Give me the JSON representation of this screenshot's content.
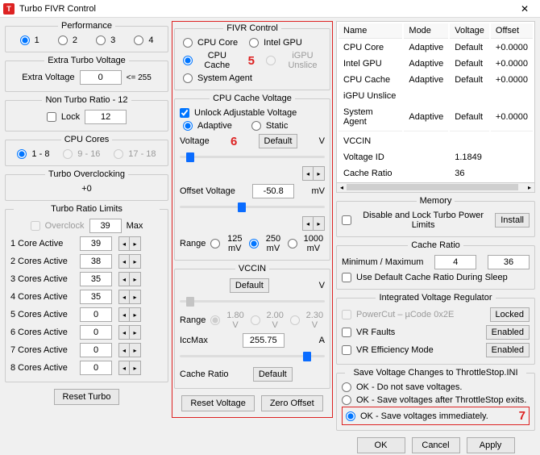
{
  "window": {
    "title": "Turbo FIVR Control",
    "icon_letter": "T"
  },
  "performance": {
    "legend": "Performance",
    "opts": [
      "1",
      "2",
      "3",
      "4"
    ],
    "selected": 0
  },
  "extra_turbo": {
    "legend": "Extra Turbo Voltage",
    "label": "Extra Voltage",
    "value": "0",
    "hint": "<= 255"
  },
  "non_turbo": {
    "legend": "Non Turbo Ratio - 12",
    "cb": "Lock",
    "value": "12"
  },
  "cpu_cores": {
    "legend": "CPU Cores",
    "opts": [
      "1 - 8",
      "9 - 16",
      "17 - 18"
    ]
  },
  "toc": {
    "legend": "Turbo Overclocking",
    "value": "+0"
  },
  "trl": {
    "legend": "Turbo Ratio Limits",
    "cb": "Overclock",
    "multi": "39",
    "multi_suffix": "Max",
    "rows": [
      {
        "label": "1 Core Active",
        "val": "39"
      },
      {
        "label": "2 Cores Active",
        "val": "38"
      },
      {
        "label": "3 Cores Active",
        "val": "35"
      },
      {
        "label": "4 Cores Active",
        "val": "35"
      },
      {
        "label": "5 Cores Active",
        "val": "0"
      },
      {
        "label": "6 Cores Active",
        "val": "0"
      },
      {
        "label": "7 Cores Active",
        "val": "0"
      },
      {
        "label": "8 Cores Active",
        "val": "0"
      }
    ]
  },
  "fivr": {
    "legend": "FIVR Control",
    "annot": "5",
    "radios": [
      [
        "CPU Core",
        "Intel GPU"
      ],
      [
        "CPU Cache",
        "iGPU Unslice"
      ],
      [
        "System Agent",
        ""
      ]
    ],
    "selected": "CPU Cache"
  },
  "cache_v": {
    "legend": "CPU Cache Voltage",
    "unlock": "Unlock Adjustable Voltage",
    "mode_opts": [
      "Adaptive",
      "Static"
    ],
    "voltage_lab": "Voltage",
    "annot": "6",
    "default_btn": "Default",
    "unit_v": "V",
    "offset_lab": "Offset Voltage",
    "offset_val": "-50.8",
    "unit_mv": "mV",
    "range_lab": "Range",
    "range_opts": [
      "125 mV",
      "250 mV",
      "1000 mV"
    ]
  },
  "vccin": {
    "legend": "VCCIN",
    "default_btn": "Default",
    "unit_v": "V",
    "range_lab": "Range",
    "range_opts": [
      "1.80 V",
      "2.00 V",
      "2.30 V"
    ],
    "icc_lab": "IccMax",
    "icc_val": "255.75",
    "icc_unit": "A",
    "cache_ratio_lab": "Cache Ratio",
    "default_btn2": "Default"
  },
  "table": {
    "headers": [
      "Name",
      "Mode",
      "Voltage",
      "Offset"
    ],
    "rows": [
      [
        "CPU Core",
        "Adaptive",
        "Default",
        "+0.0000"
      ],
      [
        "Intel GPU",
        "Adaptive",
        "Default",
        "+0.0000"
      ],
      [
        "CPU Cache",
        "Adaptive",
        "Default",
        "+0.0000"
      ],
      [
        "iGPU Unslice",
        "",
        "",
        ""
      ],
      [
        "System Agent",
        "Adaptive",
        "Default",
        "+0.0000"
      ]
    ],
    "extra": [
      [
        "VCCIN",
        "",
        "",
        ""
      ],
      [
        "Voltage ID",
        "",
        "1.1849",
        ""
      ],
      [
        "Cache Ratio",
        "",
        "36",
        ""
      ]
    ]
  },
  "memory": {
    "legend": "Memory",
    "cb": "Disable and Lock Turbo Power Limits",
    "install": "Install"
  },
  "cache_ratio": {
    "legend": "Cache Ratio",
    "minmax": "Minimum / Maximum",
    "v1": "4",
    "v2": "36",
    "sleep": "Use Default Cache Ratio During Sleep"
  },
  "ivr": {
    "legend": "Integrated Voltage Regulator",
    "pcut": "PowerCut – µCode 0x2E",
    "locked": "Locked",
    "vrf": "VR Faults",
    "vrf_btn": "Enabled",
    "vre": "VR Efficiency Mode",
    "vre_btn": "Enabled"
  },
  "save": {
    "legend": "Save Voltage Changes to ThrottleStop.INI",
    "annot": "7",
    "opts": [
      "OK - Do not save voltages.",
      "OK - Save voltages after ThrottleStop exits.",
      "OK - Save voltages immediately."
    ]
  },
  "buttons": {
    "reset_turbo": "Reset Turbo",
    "reset_voltage": "Reset Voltage",
    "zero_offset": "Zero Offset",
    "ok": "OK",
    "cancel": "Cancel",
    "apply": "Apply"
  }
}
